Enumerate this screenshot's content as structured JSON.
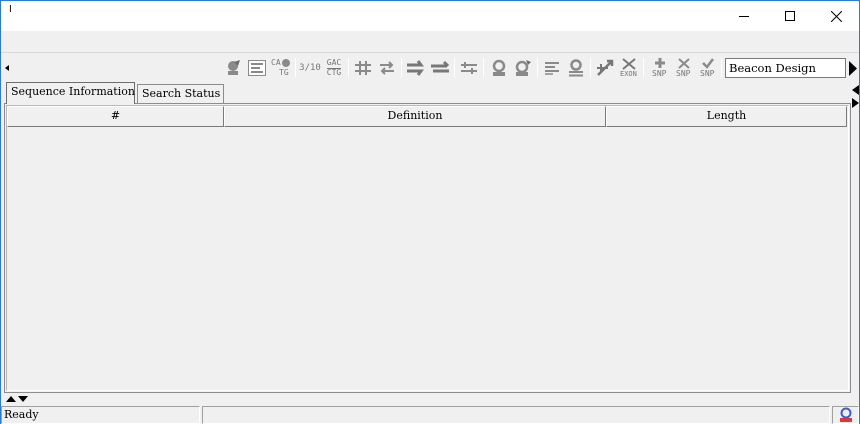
{
  "window": {
    "title": "I",
    "controls": [
      "minimize-icon",
      "maximize-icon",
      "close-icon"
    ]
  },
  "toolbar": {
    "icons": [
      "primer-search-icon",
      "alignment-view-icon",
      "ca-tg-icon",
      "ratio-3-10-icon",
      "gac-ctg-icon",
      "swap-arrows-icon",
      "exchange-arrows-icon",
      "forward-arrows-icon",
      "reverse-arrows-icon",
      "filter-arrows-icon",
      "probe-icon",
      "probe-edit-icon",
      "align-left-icon",
      "probe-base-icon",
      "cut-icon",
      "exon-delete-icon",
      "snp-add-icon",
      "snp-delete-icon",
      "snp-check-icon"
    ],
    "labels": {
      "ratio": "3/10",
      "gac": "GAC",
      "ctg": "CTG",
      "ca": "CA",
      "tg": "TG",
      "exon": "EXON",
      "snp": "SNP"
    },
    "company_combo": "Beacon Design"
  },
  "tabs": [
    {
      "label": "Sequence Information",
      "active": true
    },
    {
      "label": "Search Status",
      "active": false
    }
  ],
  "table": {
    "columns": [
      "#",
      "Definition",
      "Length"
    ],
    "rows": []
  },
  "status": {
    "text": "Ready",
    "middle": ""
  },
  "colors": {
    "window_border": "#2b7bd6",
    "background": "#f0f0f0",
    "icon_gray": "#8a8a8a",
    "status_icon": "#3a5bd9"
  }
}
